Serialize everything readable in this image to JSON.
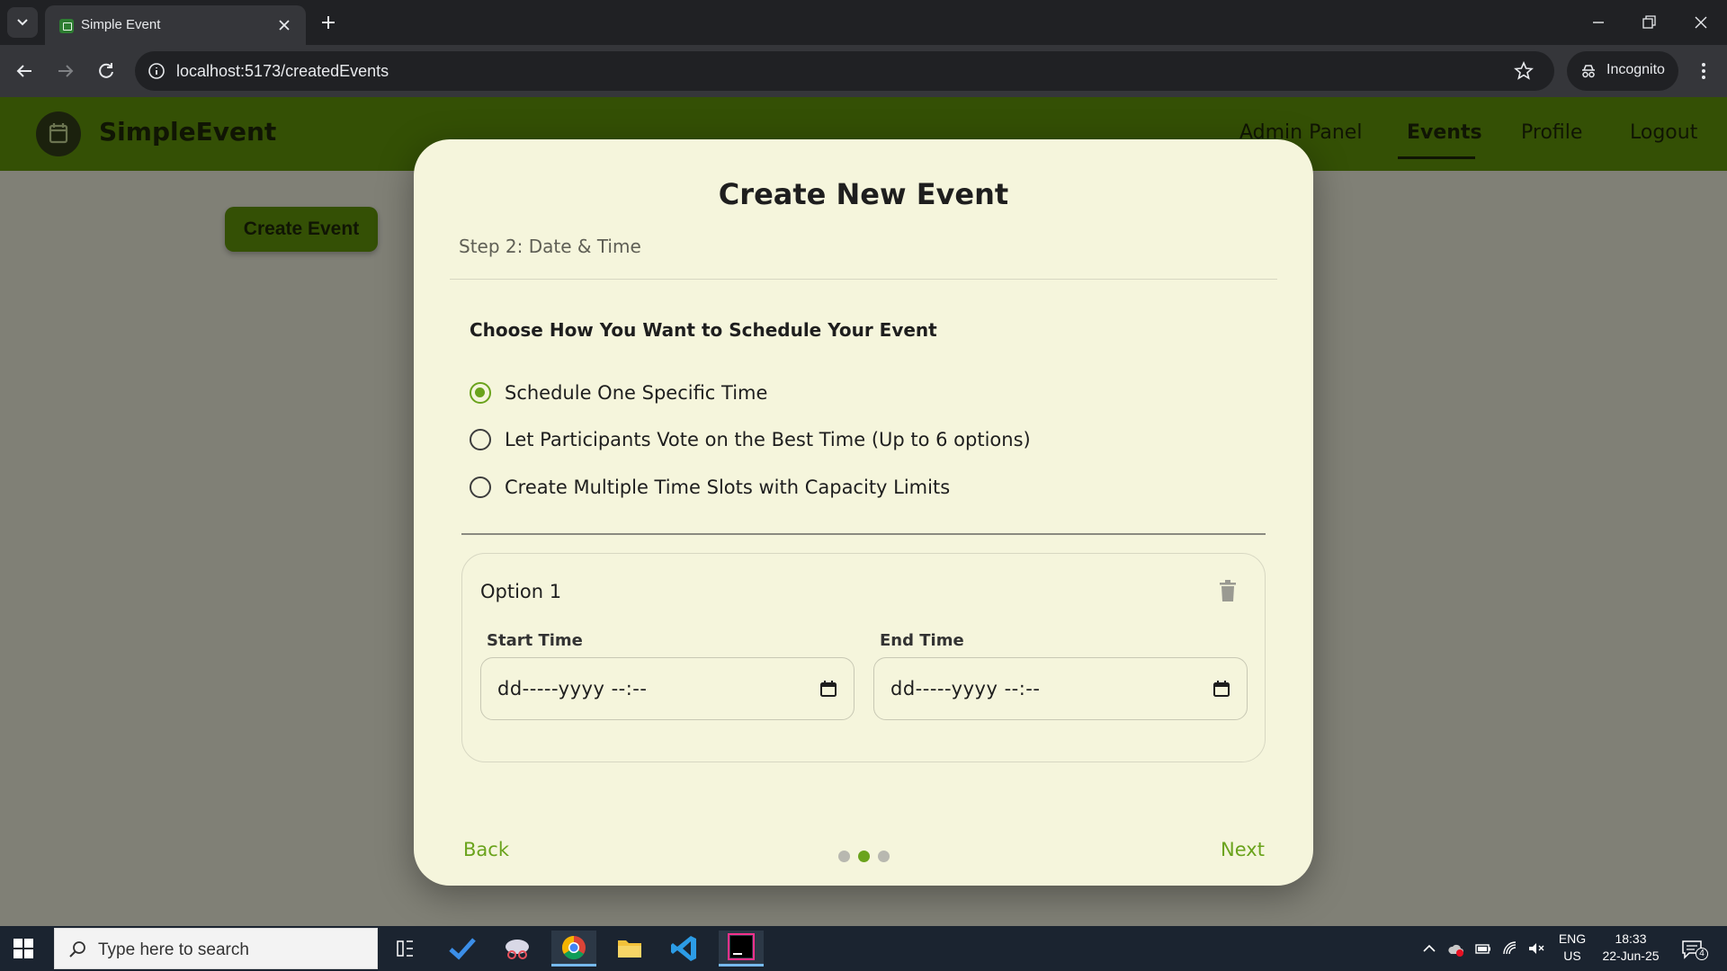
{
  "browser": {
    "tab_title": "Simple Event",
    "url": "localhost:5173/createdEvents",
    "incognito_label": "Incognito"
  },
  "app": {
    "brand": "SimpleEvent",
    "nav": [
      {
        "label": "Admin Panel"
      },
      {
        "label": "Events"
      },
      {
        "label": "Profile"
      },
      {
        "label": "Logout"
      }
    ],
    "create_button": "Create Event"
  },
  "modal": {
    "title": "Create New Event",
    "step_label": "Step 2: Date & Time",
    "section_title": "Choose How You Want to Schedule Your Event",
    "options": [
      {
        "label": "Schedule One Specific Time",
        "checked": true
      },
      {
        "label": "Let Participants Vote on the Best Time (Up to 6 options)",
        "checked": false
      },
      {
        "label": "Create Multiple Time Slots with Capacity Limits",
        "checked": false
      }
    ],
    "option_card": {
      "title": "Option 1",
      "start_label": "Start Time",
      "start_value": "dd-----yyyy --:--",
      "end_label": "End Time",
      "end_value": "dd-----yyyy --:--"
    },
    "back_label": "Back",
    "next_label": "Next",
    "step_current": 2,
    "step_total": 3
  },
  "taskbar": {
    "search_placeholder": "Type here to search",
    "lang_line1": "ENG",
    "lang_line2": "US",
    "time": "18:33",
    "date": "22-Jun-25",
    "notification_count": "4"
  },
  "colors": {
    "accent_green": "#6aa31c",
    "nav_green": "#5a8a0a",
    "modal_bg": "#f5f5dc"
  }
}
